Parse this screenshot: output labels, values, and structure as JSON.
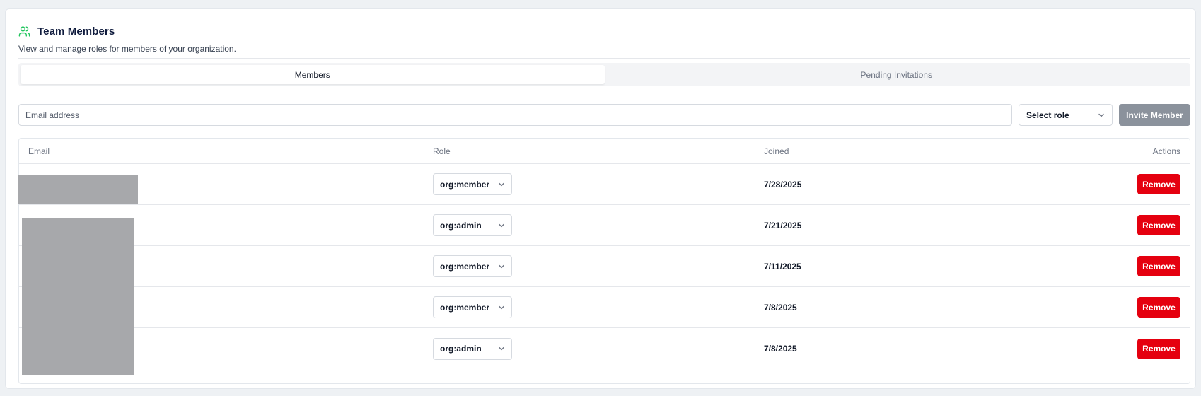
{
  "header": {
    "title": "Team Members",
    "subtitle": "View and manage roles for members of your organization.",
    "icon": "users-icon",
    "icon_color": "#22c55e"
  },
  "tabs": [
    {
      "label": "Members",
      "active": true
    },
    {
      "label": "Pending Invitations",
      "active": false
    }
  ],
  "invite": {
    "email_placeholder": "Email address",
    "email_value": "",
    "role_value": "Select role",
    "button_label": "Invite Member",
    "button_color": "#8b929c"
  },
  "table": {
    "columns": {
      "email": "Email",
      "role": "Role",
      "joined": "Joined",
      "actions": "Actions"
    },
    "rows": [
      {
        "role": "org:member",
        "joined": "7/28/2025",
        "action": "Remove"
      },
      {
        "role": "org:admin",
        "joined": "7/21/2025",
        "action": "Remove"
      },
      {
        "role": "org:member",
        "joined": "7/11/2025",
        "action": "Remove"
      },
      {
        "role": "org:member",
        "joined": "7/8/2025",
        "action": "Remove"
      },
      {
        "role": "org:admin",
        "joined": "7/8/2025",
        "action": "Remove"
      }
    ],
    "remove_color": "#e5000f"
  }
}
